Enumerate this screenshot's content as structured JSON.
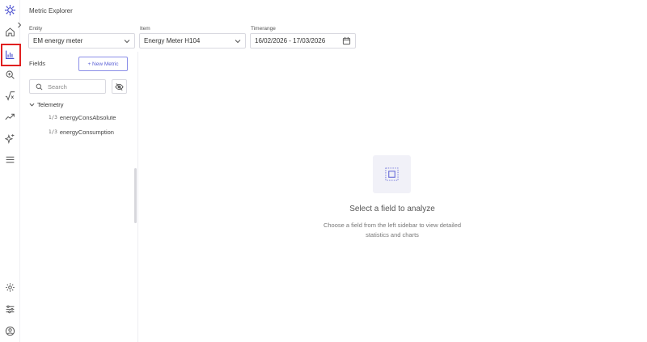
{
  "app": {
    "title": "Metric Explorer"
  },
  "rail": {
    "icons": [
      "logo-icon",
      "home-icon",
      "bar-chart-icon",
      "zoom-search-icon",
      "sqrt-formula-icon",
      "trend-line-icon",
      "sparkle-icon",
      "menu-icon",
      "settings-icon",
      "sliders-icon",
      "user-circle-icon"
    ],
    "active": "bar-chart-icon",
    "highlight_color": "#e02020"
  },
  "filters": {
    "entity": {
      "label": "Entity",
      "value": "EM energy meter"
    },
    "item": {
      "label": "Item",
      "value": "Energy Meter H104"
    },
    "timerange": {
      "label": "Timerange",
      "value": "16/02/2026 - 17/03/2026"
    }
  },
  "sidebar": {
    "title": "Fields",
    "new_metric_label": "+ New Metric",
    "search_placeholder": "Search",
    "group": {
      "label": "Telemetry",
      "items": [
        {
          "icon_text": "%",
          "label": "energyConsAbsolute"
        },
        {
          "icon_text": "%",
          "label": "energyConsumption"
        }
      ]
    }
  },
  "empty_state": {
    "title": "Select a field to analyze",
    "subtitle_line1": "Choose a field from the left sidebar to view detailed",
    "subtitle_line2": "statistics and charts"
  },
  "colors": {
    "accent": "#5b60d6",
    "accent_border": "#8b8fe8"
  }
}
